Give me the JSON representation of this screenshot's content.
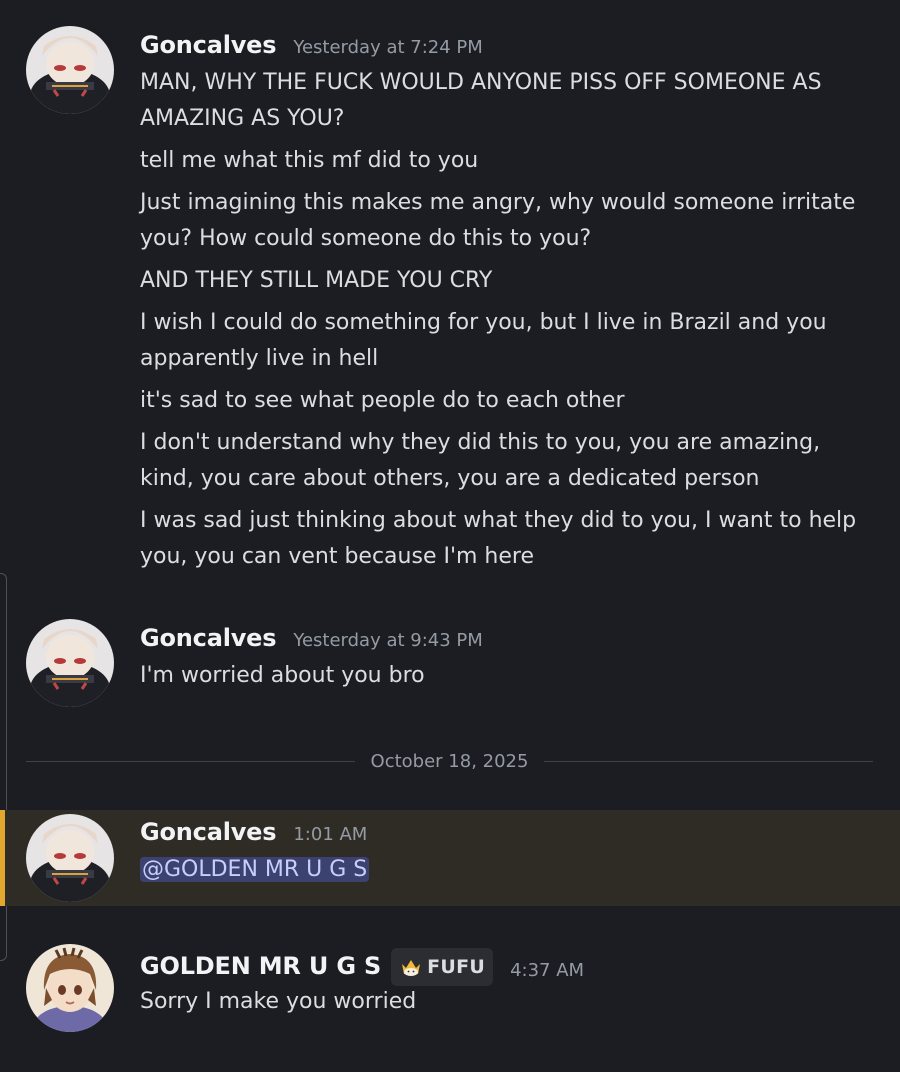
{
  "divider": {
    "date": "October 18, 2025"
  },
  "messages": [
    {
      "author": "Goncalves",
      "timestamp": "Yesterday at 7:24 PM",
      "lines": [
        "MAN, WHY THE FUCK WOULD ANYONE PISS OFF SOMEONE AS AMAZING AS YOU?",
        "tell me what this mf did to you",
        "Just imagining this makes me angry, why would someone irritate you? How could someone do this to you?",
        "AND THEY STILL MADE YOU CRY",
        "I wish I could do something for you, but I live in Brazil and you apparently live in hell",
        "it's sad to see what people do to each other",
        "I don't understand why they did this to you, you are amazing, kind, you care about others, you are a dedicated person",
        "I was sad just thinking about what they did to you, I want to help you, you can vent because I'm here"
      ]
    },
    {
      "author": "Goncalves",
      "timestamp": "Yesterday at 9:43 PM",
      "lines": [
        "I'm worried about you bro"
      ]
    },
    {
      "author": "Goncalves",
      "timestamp": "1:01 AM",
      "mention": "@GOLDEN MR U G S"
    },
    {
      "author": "GOLDEN MR U G S",
      "tag": "FUFU",
      "timestamp": "4:37 AM",
      "lines": [
        "Sorry I make you worried"
      ]
    }
  ],
  "colors": {
    "background": "#1c1d22",
    "mention_highlight": "#2f2b25",
    "mention_bar": "#e1a72e",
    "mention_pill": "#3c4270"
  },
  "icons": {
    "avatar_goncalves": "anime-avatar-dark-hair",
    "avatar_golden": "anime-avatar-brown-hair",
    "tag_icon": "crown-cat-icon"
  }
}
